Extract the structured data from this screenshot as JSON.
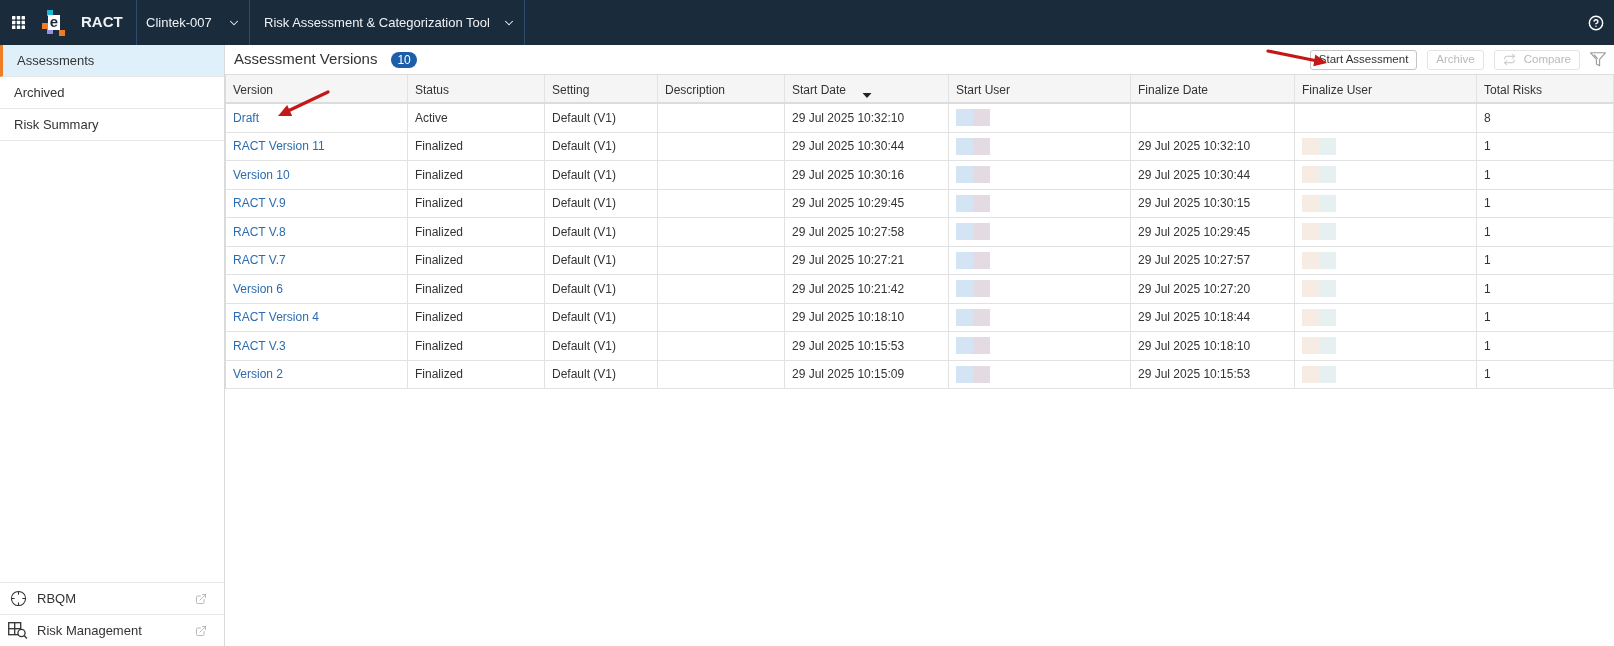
{
  "top_bar": {
    "logo_letter": "e",
    "app_name": "RACT",
    "study": "Clintek-007",
    "tool": "Risk Assessment & Categorization Tool"
  },
  "sidebar": {
    "items": [
      {
        "label": "Assessments",
        "selected": true
      },
      {
        "label": "Archived",
        "selected": false
      },
      {
        "label": "Risk Summary",
        "selected": false
      }
    ],
    "links": [
      {
        "label": "RBQM"
      },
      {
        "label": "Risk Management"
      }
    ]
  },
  "main": {
    "title": "Assessment Versions",
    "count": "10",
    "buttons": [
      {
        "label": "Start Assessment",
        "kind": "text",
        "disabled": false
      },
      {
        "label": "Archive",
        "kind": "text",
        "disabled": true
      },
      {
        "label": "Compare",
        "kind": "compare",
        "disabled": true
      }
    ]
  },
  "table": {
    "columns": [
      {
        "label": "Version",
        "sorted": false
      },
      {
        "label": "Status",
        "sorted": false
      },
      {
        "label": "Setting",
        "sorted": false
      },
      {
        "label": "Description",
        "sorted": false
      },
      {
        "label": "Start Date",
        "sorted": true
      },
      {
        "label": "Start User",
        "sorted": false
      },
      {
        "label": "Finalize Date",
        "sorted": false
      },
      {
        "label": "Finalize User",
        "sorted": false
      },
      {
        "label": "Total Risks",
        "sorted": false
      }
    ],
    "rows": [
      {
        "version": "Draft",
        "status": "Active",
        "setting": "Default (V1)",
        "start_date": "29 Jul 2025 10:32:10",
        "start_user_redacted": true,
        "finalize_user_redacted": false,
        "total_risks": "8"
      },
      {
        "version": "RACT Version 11",
        "status": "Finalized",
        "setting": "Default (V1)",
        "start_date": "29 Jul 2025 10:30:44",
        "start_user_redacted": true,
        "finalize_date": "29 Jul 2025 10:32:10",
        "finalize_user_redacted": true,
        "total_risks": "1"
      },
      {
        "version": "Version 10",
        "status": "Finalized",
        "setting": "Default (V1)",
        "start_date": "29 Jul 2025 10:30:16",
        "start_user_redacted": true,
        "finalize_date": "29 Jul 2025 10:30:44",
        "finalize_user_redacted": true,
        "total_risks": "1"
      },
      {
        "version": "RACT V.9",
        "status": "Finalized",
        "setting": "Default (V1)",
        "start_date": "29 Jul 2025 10:29:45",
        "start_user_redacted": true,
        "finalize_date": "29 Jul 2025 10:30:15",
        "finalize_user_redacted": true,
        "total_risks": "1"
      },
      {
        "version": "RACT V.8",
        "status": "Finalized",
        "setting": "Default (V1)",
        "start_date": "29 Jul 2025 10:27:58",
        "start_user_redacted": true,
        "finalize_date": "29 Jul 2025 10:29:45",
        "finalize_user_redacted": true,
        "total_risks": "1"
      },
      {
        "version": "RACT V.7",
        "status": "Finalized",
        "setting": "Default (V1)",
        "start_date": "29 Jul 2025 10:27:21",
        "start_user_redacted": true,
        "finalize_date": "29 Jul 2025 10:27:57",
        "finalize_user_redacted": true,
        "total_risks": "1"
      },
      {
        "version": "Version 6",
        "status": "Finalized",
        "setting": "Default (V1)",
        "start_date": "29 Jul 2025 10:21:42",
        "start_user_redacted": true,
        "finalize_date": "29 Jul 2025 10:27:20",
        "finalize_user_redacted": true,
        "total_risks": "1"
      },
      {
        "version": "RACT Version 4",
        "status": "Finalized",
        "setting": "Default (V1)",
        "start_date": "29 Jul 2025 10:18:10",
        "start_user_redacted": true,
        "finalize_date": "29 Jul 2025 10:18:44",
        "finalize_user_redacted": true,
        "total_risks": "1"
      },
      {
        "version": "RACT V.3",
        "status": "Finalized",
        "setting": "Default (V1)",
        "start_date": "29 Jul 2025 10:15:53",
        "start_user_redacted": true,
        "finalize_date": "29 Jul 2025 10:18:10",
        "finalize_user_redacted": true,
        "total_risks": "1"
      },
      {
        "version": "Version 2",
        "status": "Finalized",
        "setting": "Default (V1)",
        "start_date": "29 Jul 2025 10:15:09",
        "start_user_redacted": true,
        "finalize_date": "29 Jul 2025 10:15:53",
        "finalize_user_redacted": true,
        "total_risks": "1"
      }
    ]
  }
}
